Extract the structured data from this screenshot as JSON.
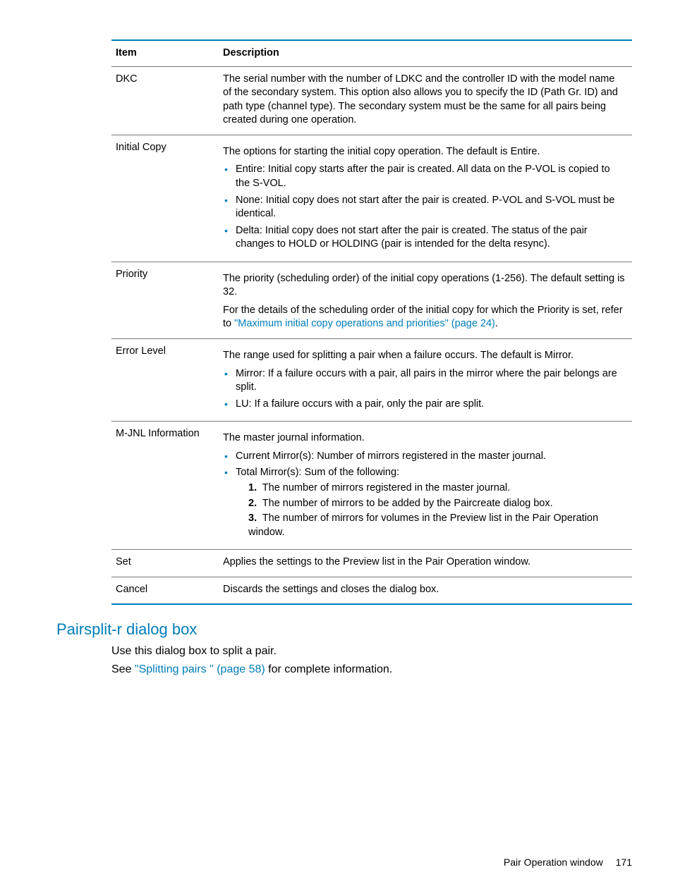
{
  "table": {
    "headers": {
      "item": "Item",
      "description": "Description"
    },
    "rows": {
      "dkc": {
        "item": "DKC",
        "desc": "The serial number with the number of LDKC and the controller ID with the model name of the secondary system. This option also allows you to specify the ID (Path Gr. ID) and path type (channel type). The secondary system must be the same for all pairs being created during one operation."
      },
      "initial_copy": {
        "item": "Initial Copy",
        "intro": "The options for starting the initial copy operation. The default is Entire.",
        "bullets": [
          "Entire: Initial copy starts after the pair is created. All data on the P-VOL is copied to the S-VOL.",
          "None: Initial copy does not start after the pair is created. P-VOL and S-VOL must be identical.",
          "Delta: Initial copy does not start after the pair is created. The status of the pair changes to HOLD or HOLDING (pair is intended for the delta resync)."
        ]
      },
      "priority": {
        "item": "Priority",
        "line1": "The priority (scheduling order) of the initial copy operations (1-256). The default setting is 32.",
        "line2_pre": "For the details of the scheduling order of the initial copy for which the Priority is set, refer to ",
        "link": "\"Maximum initial copy operations and priorities\" (page 24)",
        "line2_post": "."
      },
      "error_level": {
        "item": "Error Level",
        "intro": "The range used for splitting a pair when a failure occurs. The default is Mirror.",
        "bullets": [
          "Mirror: If a failure occurs with a pair, all pairs in the mirror where the pair belongs are split.",
          "LU: If a failure occurs with a pair, only the pair are split."
        ]
      },
      "mjnl": {
        "item": "M-JNL Information",
        "intro": "The master journal information.",
        "b1": "Current Mirror(s): Number of mirrors registered in the master journal.",
        "b2": "Total Mirror(s): Sum of the following:",
        "n1": "The number of mirrors registered in the master journal.",
        "n2": "The number of mirrors to be added by the Paircreate dialog box.",
        "n3": "The number of mirrors for volumes in the Preview list in the Pair Operation window."
      },
      "set": {
        "item": "Set",
        "desc": "Applies the settings to the Preview list in the Pair Operation window."
      },
      "cancel": {
        "item": "Cancel",
        "desc": "Discards the settings and closes the dialog box."
      }
    }
  },
  "heading": "Pairsplit-r dialog box",
  "body": {
    "line1": "Use this dialog box to split a pair.",
    "line2_pre": "See ",
    "link": "\"Splitting pairs \" (page 58)",
    "line2_post": " for complete information."
  },
  "footer": {
    "section": "Pair Operation window",
    "page": "171"
  }
}
